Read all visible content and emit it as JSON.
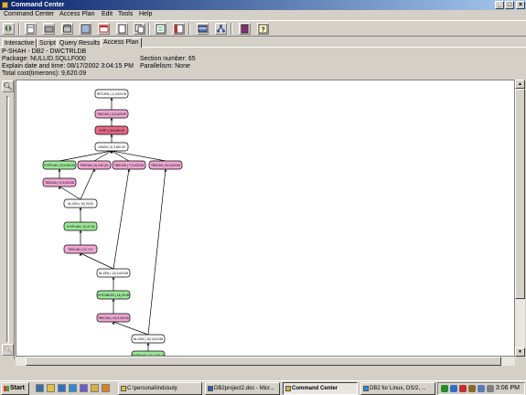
{
  "window": {
    "title": "Command Center",
    "controls": [
      "_",
      "□",
      "×"
    ]
  },
  "menu": [
    "Command Center",
    "Access Plan",
    "Edit",
    "Tools",
    "Help"
  ],
  "toolbar": {
    "icons": [
      "command-center-icon",
      "script-icon",
      "toolbox-icon",
      "database-icon",
      "picture-icon",
      "window-icon",
      "page-icon",
      "copy-icon",
      "stats-icon",
      "panel-icon",
      "table-icon",
      "tree-icon",
      "book-icon",
      "help-icon"
    ]
  },
  "tabs": [
    "Interactive",
    "Script",
    "Query Results",
    "Access Plan"
  ],
  "active_tab": "Access Plan",
  "info": {
    "line1": "P-SHAH - DB2 - DWCTRLDB",
    "package": "Package: NULLID.SQLLF000",
    "explained": "Explain date and time: 08/17/2002 3:04:15 PM",
    "cost": "Total cost(timerons): 9,620.09",
    "section": "Section number: 65",
    "parallelism": "Parallelism: None"
  },
  "plan": {
    "colors": {
      "return": "#ffffff",
      "tbscan": "#f0a8d4",
      "sort": "#e86a86",
      "join": "#ffffff",
      "table": "#9ee89a"
    },
    "nodes": [
      {
        "id": "n1",
        "label": "RETURN ( 1) 9,620.09",
        "kind": "return"
      },
      {
        "id": "n2",
        "label": "TBSCAN ( 2) 9,620.09",
        "kind": "tbscan"
      },
      {
        "id": "n3",
        "label": "SORT ( 3) 9,620.09",
        "kind": "sort"
      },
      {
        "id": "n4",
        "label": "UNION ( 4) 9,620.09",
        "kind": "join"
      },
      {
        "id": "n5",
        "label": "SYSPLAN ( 5) 9,620.09",
        "kind": "table"
      },
      {
        "id": "n6",
        "label": "TBSCAN ( 6) 6.50 (D)",
        "kind": "tbscan"
      },
      {
        "id": "n7",
        "label": "TBSCAN ( 7) 3,620.08",
        "kind": "tbscan"
      },
      {
        "id": "n8",
        "label": "TBSCAN ( 8) 3,620.08",
        "kind": "tbscan"
      },
      {
        "id": "n9",
        "label": "TBSCAN ( 9) 3,620.08",
        "kind": "tbscan"
      },
      {
        "id": "n10",
        "label": "NLJOIN ( 10) 29.53",
        "kind": "join"
      },
      {
        "id": "n11",
        "label": "SYSPLAN ( 11) 22.53",
        "kind": "table"
      },
      {
        "id": "n12",
        "label": "TBSCAN ( 12) 7.07",
        "kind": "tbscan"
      },
      {
        "id": "n13",
        "label": "NLJOIN ( 13) 3,620.08",
        "kind": "join"
      },
      {
        "id": "n14",
        "label": "SYSTABLES ( 14) 25.59",
        "kind": "table"
      },
      {
        "id": "n15",
        "label": "TBSCAN ( 15) 3,020.56",
        "kind": "tbscan"
      },
      {
        "id": "n16",
        "label": "NLJOIN ( 16) 3,620.56",
        "kind": "join"
      },
      {
        "id": "n17",
        "label": "SYSPLAN ( 17) 2,432.16",
        "kind": "table"
      }
    ],
    "edges": [
      [
        "n2",
        "n1"
      ],
      [
        "n3",
        "n2"
      ],
      [
        "n4",
        "n3"
      ],
      [
        "n5",
        "n4"
      ],
      [
        "n6",
        "n4"
      ],
      [
        "n7",
        "n4"
      ],
      [
        "n8",
        "n4"
      ],
      [
        "n6",
        "n5"
      ],
      [
        "n10",
        "n6"
      ],
      [
        "n11",
        "n10"
      ],
      [
        "n12",
        "n11"
      ],
      [
        "n13",
        "n12"
      ],
      [
        "n9",
        "n13"
      ],
      [
        "n14",
        "n13"
      ],
      [
        "n15",
        "n14"
      ],
      [
        "n16",
        "n15"
      ],
      [
        "n8",
        "n16"
      ],
      [
        "n17",
        "n16"
      ]
    ]
  },
  "taskbar": {
    "start": "Start",
    "quicklaunch": [
      "desktop-icon",
      "explorer-icon",
      "outlook-icon",
      "ie-icon",
      "media-icon",
      "folder-icon",
      "winamp-icon"
    ],
    "tasks": [
      {
        "label": "C:\\personal\\indstudy",
        "icon": "folder-icon"
      },
      {
        "label": "DB2project2.doc - Micr...",
        "icon": "word-icon"
      },
      {
        "label": "Command Center",
        "icon": "command-center-icon"
      },
      {
        "label": "DB2 for Linux, OS/2, ...",
        "icon": "ie-icon"
      }
    ],
    "active_task": "Command Center",
    "clock": "3:06 PM"
  }
}
